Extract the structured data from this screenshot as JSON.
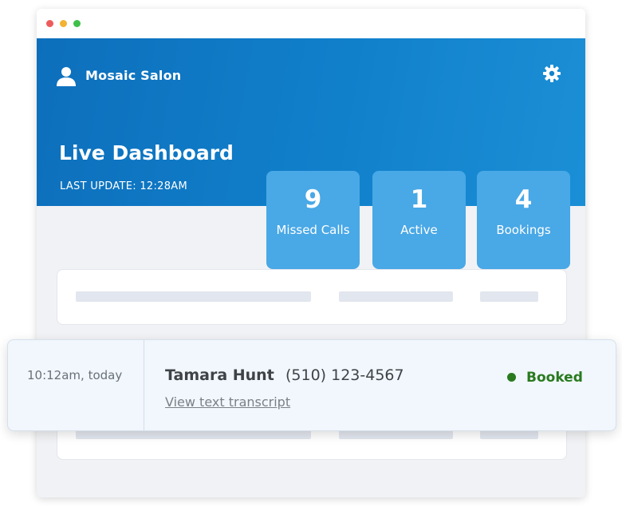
{
  "window": {
    "controls": [
      "close",
      "minimize",
      "maximize"
    ]
  },
  "header": {
    "user_icon": "user-icon",
    "business_name": "Mosaic Salon",
    "settings_icon": "gear-icon"
  },
  "dashboard": {
    "title": "Live Dashboard",
    "last_update": "LAST UPDATE: 12:28AM"
  },
  "stats": [
    {
      "value": "9",
      "label": "Missed Calls"
    },
    {
      "value": "1",
      "label": "Active"
    },
    {
      "value": "4",
      "label": "Bookings"
    }
  ],
  "call": {
    "time": "10:12am, today",
    "caller_name": "Tamara Hunt",
    "caller_phone": "(510) 123-4567",
    "transcript_link": "View text transcript",
    "status": "Booked",
    "status_color": "#2a7a1f"
  },
  "colors": {
    "hero_blue": "#0d6fbc",
    "card_blue": "#49a8e6"
  }
}
